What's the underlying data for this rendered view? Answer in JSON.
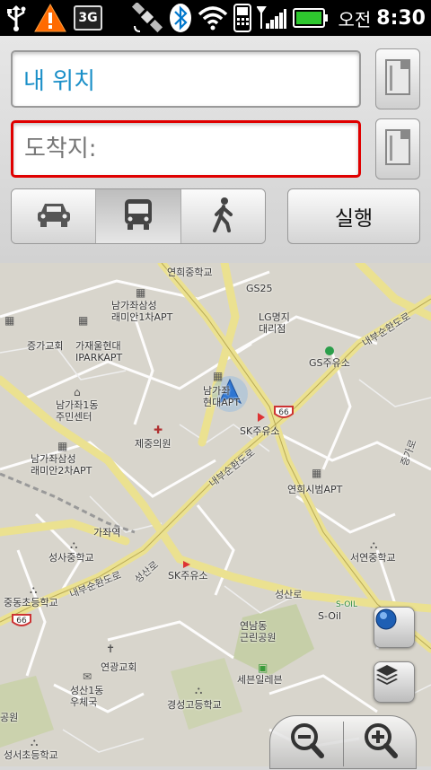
{
  "status_bar": {
    "ampm": "오전",
    "time": "8:30",
    "network_badge": "3G",
    "icons": [
      "usb-icon",
      "warning-icon",
      "3g-data-icon",
      "satellite-gps-icon",
      "bluetooth-icon",
      "wifi-icon",
      "phone-signal-icon",
      "battery-icon"
    ],
    "battery_color": "#2ec82e"
  },
  "directions": {
    "start_value": "내 위치",
    "destination_placeholder": "도착지:",
    "destination_value": "",
    "go_label": "실행",
    "modes": [
      {
        "name": "car",
        "icon": "car-icon",
        "selected": false
      },
      {
        "name": "transit",
        "icon": "bus-icon",
        "selected": true
      },
      {
        "name": "walk",
        "icon": "walking-icon",
        "selected": false
      }
    ],
    "accent_color": "#1a8fc8",
    "error_border_color": "#e00000"
  },
  "map": {
    "labels": {
      "l1": "연희중학교",
      "l2": "GS25",
      "l3": "남가좌삼성\n래미안1차APT",
      "l4": "LG명지\n대리점",
      "l5": "증가교회",
      "l6": "가재울현대\nIPARKAPT",
      "l7": "내부순환도로",
      "l8": "GS주유소",
      "l9": "남가좌1동\n주민센터",
      "l10": "남가좌\n현대APT",
      "l11": "제중의원",
      "l12": "SK주유소",
      "l13": "증가로",
      "l14": "남가좌삼성\n래미안2차APT",
      "l15": "내부순환도로",
      "l16": "연희시범APT",
      "l17": "가좌역",
      "l18": "성사중학교",
      "l19": "서연중학교",
      "l20": "성산로",
      "l21": "SK주유소",
      "l22": "내부순환도로",
      "l23": "중동초등학교",
      "l24": "성산로",
      "l25": "S-Oil",
      "l26": "연남동\n근린공원",
      "l27": "연광교회",
      "l28": "세븐일레븐",
      "l29": "성산1동\n우체국",
      "l30": "경성고등학교",
      "l31": "공원",
      "l32": "성서초등학교",
      "l33": "S-OIL"
    },
    "route_shields": [
      "66",
      "66"
    ],
    "controls": [
      "my-location-button",
      "layers-button",
      "zoom-out-button",
      "zoom-in-button"
    ]
  }
}
